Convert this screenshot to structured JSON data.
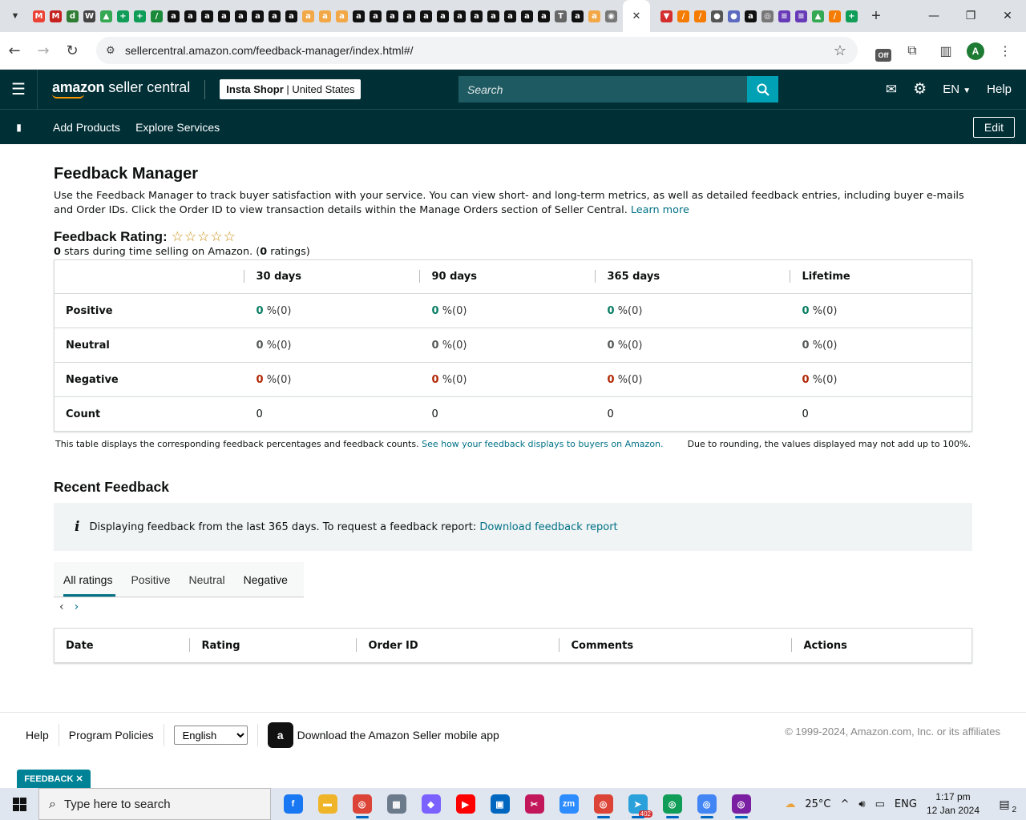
{
  "browser": {
    "active_tab_close": "✕",
    "new_tab": "+",
    "url": "sellercentral.amazon.com/feedback-manager/index.html#/",
    "tabs": [
      {
        "icon": "gmail-icon",
        "glyph": "M",
        "color": "#ea4335"
      },
      {
        "icon": "gmail-icon",
        "glyph": "M",
        "color": "#c5221f"
      },
      {
        "icon": "site-icon",
        "glyph": "d",
        "color": "#2e7d32"
      },
      {
        "icon": "wix-icon",
        "glyph": "W",
        "color": "#444"
      },
      {
        "icon": "drive-icon",
        "glyph": "▲",
        "color": "#34a853"
      },
      {
        "icon": "sheets-icon",
        "glyph": "+",
        "color": "#0f9d58"
      },
      {
        "icon": "sheets-icon",
        "glyph": "+",
        "color": "#0f9d58"
      },
      {
        "icon": "site-icon",
        "glyph": "/",
        "color": "#1b8a3a"
      },
      {
        "icon": "amazon-icon",
        "glyph": "a",
        "color": "#111"
      },
      {
        "icon": "amazon-icon",
        "glyph": "a",
        "color": "#111"
      },
      {
        "icon": "amazon-icon",
        "glyph": "a",
        "color": "#111"
      },
      {
        "icon": "amazon-icon",
        "glyph": "a",
        "color": "#111"
      },
      {
        "icon": "amazon-icon",
        "glyph": "a",
        "color": "#111"
      },
      {
        "icon": "amazon-icon",
        "glyph": "a",
        "color": "#111"
      },
      {
        "icon": "amazon-icon",
        "glyph": "a",
        "color": "#111"
      },
      {
        "icon": "amazon-icon",
        "glyph": "a",
        "color": "#111"
      },
      {
        "icon": "amazon-smile-icon",
        "glyph": "a",
        "color": "#f3a847"
      },
      {
        "icon": "amazon-smile-icon",
        "glyph": "a",
        "color": "#f3a847"
      },
      {
        "icon": "amazon-smile-icon",
        "glyph": "a",
        "color": "#f3a847"
      },
      {
        "icon": "amazon-icon",
        "glyph": "a",
        "color": "#111"
      },
      {
        "icon": "amazon-icon",
        "glyph": "a",
        "color": "#111"
      },
      {
        "icon": "amazon-icon",
        "glyph": "a",
        "color": "#111"
      },
      {
        "icon": "amazon-icon",
        "glyph": "a",
        "color": "#111"
      },
      {
        "icon": "amazon-icon",
        "glyph": "a",
        "color": "#111"
      },
      {
        "icon": "amazon-icon",
        "glyph": "a",
        "color": "#111"
      },
      {
        "icon": "amazon-icon",
        "glyph": "a",
        "color": "#111"
      },
      {
        "icon": "amazon-icon",
        "glyph": "a",
        "color": "#111"
      },
      {
        "icon": "amazon-icon",
        "glyph": "a",
        "color": "#111"
      },
      {
        "icon": "amazon-icon",
        "glyph": "a",
        "color": "#111"
      },
      {
        "icon": "amazon-icon",
        "glyph": "a",
        "color": "#111"
      },
      {
        "icon": "amazon-icon",
        "glyph": "a",
        "color": "#111"
      },
      {
        "icon": "site-icon",
        "glyph": "T",
        "color": "#666"
      },
      {
        "icon": "amazon-icon",
        "glyph": "a",
        "color": "#111"
      },
      {
        "icon": "amazon-smile-icon",
        "glyph": "a",
        "color": "#f3a847"
      },
      {
        "icon": "globe-icon",
        "glyph": "◉",
        "color": "#777"
      }
    ],
    "tabs_after": [
      {
        "icon": "site-icon",
        "glyph": "▼",
        "color": "#d32f2f"
      },
      {
        "icon": "site-icon",
        "glyph": "/",
        "color": "#f57c00"
      },
      {
        "icon": "site-icon",
        "glyph": "/",
        "color": "#f57c00"
      },
      {
        "icon": "site-icon",
        "glyph": "●",
        "color": "#555"
      },
      {
        "icon": "site-icon",
        "glyph": "●",
        "color": "#5c6bc0"
      },
      {
        "icon": "amazon-icon",
        "glyph": "a",
        "color": "#111"
      },
      {
        "icon": "chrome-icon",
        "glyph": "◎",
        "color": "#777"
      },
      {
        "icon": "forms-icon",
        "glyph": "≡",
        "color": "#673ab7"
      },
      {
        "icon": "forms-icon",
        "glyph": "≡",
        "color": "#673ab7"
      },
      {
        "icon": "drive-icon",
        "glyph": "▲",
        "color": "#34a853"
      },
      {
        "icon": "site-icon",
        "glyph": "/",
        "color": "#f57c00"
      },
      {
        "icon": "sheets-icon",
        "glyph": "+",
        "color": "#0f9d58"
      }
    ],
    "profile_initial": "A",
    "ext_badge": "Off"
  },
  "header": {
    "logo_brand": "amazon",
    "logo_product": "seller central",
    "store_name": "Insta Shopr",
    "store_region": "United States",
    "search_placeholder": "Search",
    "language": "EN",
    "help": "Help"
  },
  "subnav": {
    "links": [
      "Add Products",
      "Explore Services"
    ],
    "edit": "Edit"
  },
  "page": {
    "title": "Feedback Manager",
    "intro": "Use the Feedback Manager to track buyer satisfaction with your service. You can view short- and long-term metrics, as well as detailed feedback entries, including buyer e-mails and Order IDs. Click the Order ID to view transaction details within the Manage Orders section of Seller Central.",
    "learn_more": "Learn more",
    "rating_label": "Feedback Rating:",
    "stars": "☆☆☆☆☆",
    "stars_value": "0",
    "stars_text": "stars during time selling on Amazon. (",
    "ratings_count": "0",
    "ratings_text": "ratings)"
  },
  "metrics": {
    "columns": [
      "30 days",
      "90 days",
      "365 days",
      "Lifetime"
    ],
    "rows": [
      {
        "label": "Positive",
        "cells": [
          {
            "v": "0",
            "p": "%(0)"
          },
          {
            "v": "0",
            "p": "%(0)"
          },
          {
            "v": "0",
            "p": "%(0)"
          },
          {
            "v": "0",
            "p": "%(0)"
          }
        ],
        "tone": "pos"
      },
      {
        "label": "Neutral",
        "cells": [
          {
            "v": "0",
            "p": "%(0)"
          },
          {
            "v": "0",
            "p": "%(0)"
          },
          {
            "v": "0",
            "p": "%(0)"
          },
          {
            "v": "0",
            "p": "%(0)"
          }
        ],
        "tone": "neu"
      },
      {
        "label": "Negative",
        "cells": [
          {
            "v": "0",
            "p": "%(0)"
          },
          {
            "v": "0",
            "p": "%(0)"
          },
          {
            "v": "0",
            "p": "%(0)"
          },
          {
            "v": "0",
            "p": "%(0)"
          }
        ],
        "tone": "neg"
      },
      {
        "label": "Count",
        "cells": [
          {
            "v": "0",
            "p": ""
          },
          {
            "v": "0",
            "p": ""
          },
          {
            "v": "0",
            "p": ""
          },
          {
            "v": "0",
            "p": ""
          }
        ],
        "tone": "count"
      }
    ],
    "note": "This table displays the corresponding feedback percentages and feedback counts.",
    "note_link": "See how your feedback displays to buyers on Amazon.",
    "rounding_note": "Due to rounding, the values displayed may not add up to 100%."
  },
  "recent": {
    "title": "Recent Feedback",
    "info": "Displaying feedback from the last 365 days. To request a feedback report:",
    "info_link": "Download feedback report",
    "tabs": [
      "All ratings",
      "Positive",
      "Neutral",
      "Negative"
    ],
    "active_tab": "All ratings",
    "columns": [
      "Date",
      "Rating",
      "Order ID",
      "Comments",
      "Actions"
    ]
  },
  "footer": {
    "help": "Help",
    "policies": "Program Policies",
    "language_selected": "English",
    "app_text": "Download the Amazon Seller mobile app",
    "copyright": "© 1999-2024, Amazon.com, Inc. or its affiliates",
    "feedback_tab": "FEEDBACK ✕"
  },
  "taskbar": {
    "search_placeholder": "Type here to search",
    "apps": [
      {
        "name": "facebook",
        "glyph": "f",
        "color": "#1877f2",
        "running": false
      },
      {
        "name": "file-explorer",
        "glyph": "▬",
        "color": "#f0b429",
        "running": false
      },
      {
        "name": "chrome",
        "glyph": "◎",
        "color": "#db4437",
        "running": true
      },
      {
        "name": "calculator",
        "glyph": "▦",
        "color": "#6b7b8c",
        "running": false
      },
      {
        "name": "copilot",
        "glyph": "◆",
        "color": "#7b61ff",
        "running": false
      },
      {
        "name": "youtube",
        "glyph": "▶",
        "color": "#ff0000",
        "running": false
      },
      {
        "name": "store",
        "glyph": "▣",
        "color": "#0067c0",
        "running": false
      },
      {
        "name": "snipping",
        "glyph": "✂",
        "color": "#c2185b",
        "running": false
      },
      {
        "name": "zoom",
        "glyph": "zm",
        "color": "#2d8cff",
        "running": false
      },
      {
        "name": "chrome",
        "glyph": "◎",
        "color": "#db4437",
        "running": true
      },
      {
        "name": "telegram",
        "glyph": "➤",
        "color": "#2aa1da",
        "running": true
      },
      {
        "name": "chrome",
        "glyph": "◎",
        "color": "#0f9d58",
        "running": true
      },
      {
        "name": "chrome",
        "glyph": "◎",
        "color": "#4285f4",
        "running": true
      },
      {
        "name": "chrome",
        "glyph": "◎",
        "color": "#7b1fa2",
        "running": true
      }
    ],
    "telegram_badge": "402",
    "temperature": "25°C",
    "lang": "ENG",
    "time": "1:17 pm",
    "date": "12 Jan 2024",
    "notifications": "2"
  }
}
